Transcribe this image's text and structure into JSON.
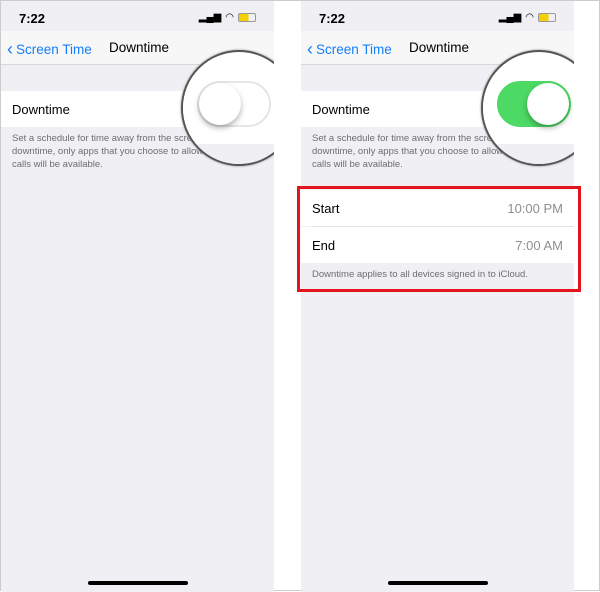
{
  "status": {
    "time": "7:22"
  },
  "nav": {
    "back": "Screen Time",
    "title": "Downtime"
  },
  "left": {
    "row_label": "Downtime",
    "toggle_on": false,
    "footer": "Set a schedule for time away from the screen. During downtime, only apps that you choose to allow and phone calls will be available."
  },
  "right": {
    "row_label": "Downtime",
    "toggle_on": true,
    "footer": "Set a schedule for time away from the screen. During downtime, only apps that you choose to allow and phone calls will be available.",
    "start_label": "Start",
    "start_value": "10:00 PM",
    "end_label": "End",
    "end_value": "7:00 AM",
    "schedule_footer": "Downtime applies to all devices signed in to iCloud."
  },
  "colors": {
    "accent": "#157efb",
    "toggle_on": "#4cd964",
    "highlight": "#e4141f"
  }
}
